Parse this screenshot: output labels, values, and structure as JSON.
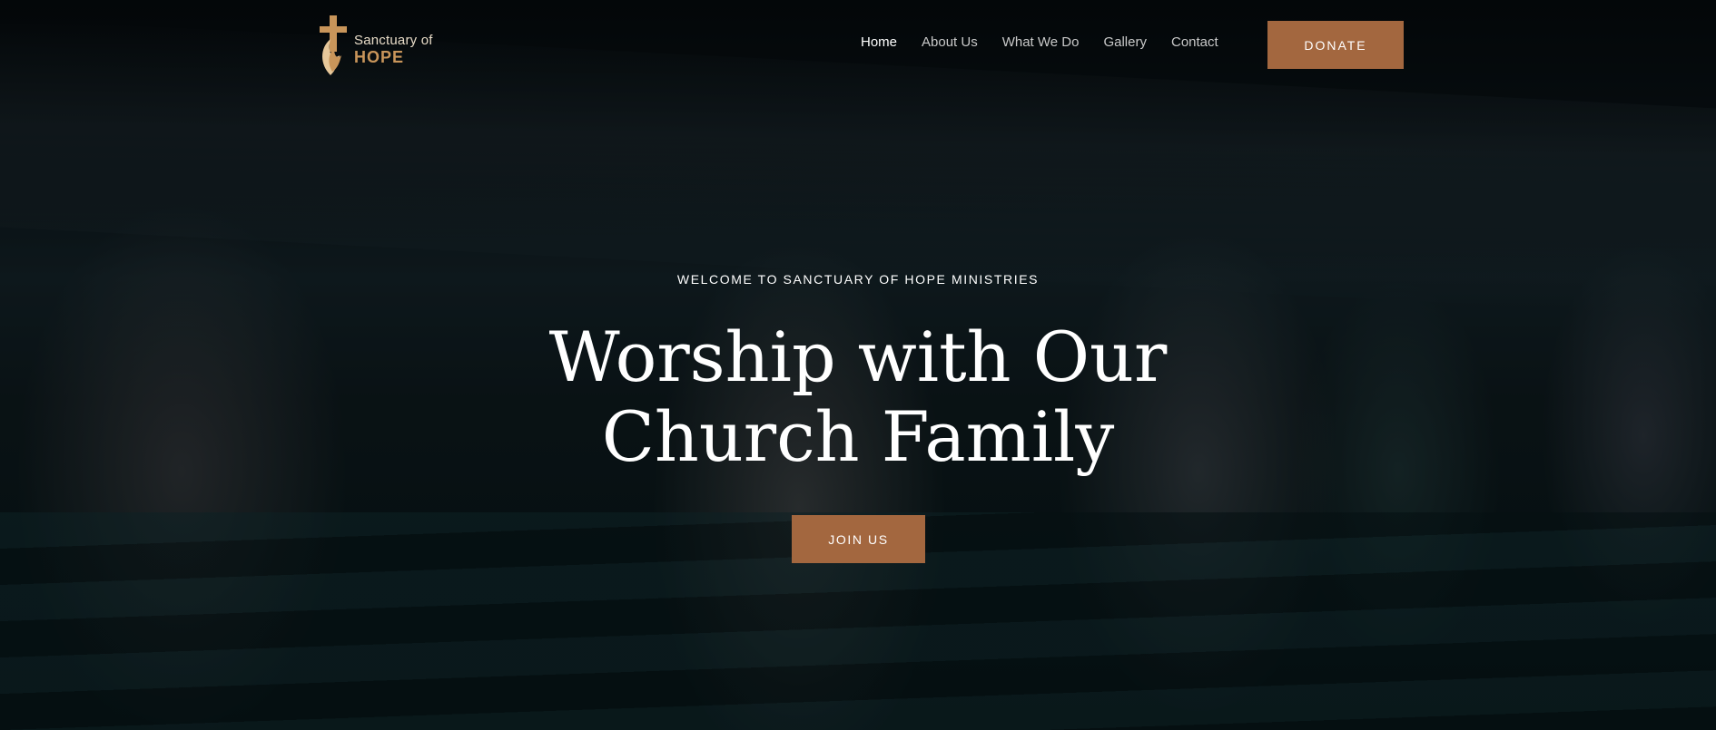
{
  "brand": {
    "name_line1": "Sanctuary of",
    "name_line2": "HOPE",
    "logo_icon": "cross-flame-icon",
    "colors": {
      "accent": "#a3673f",
      "gold": "#c8955a"
    }
  },
  "nav": {
    "items": [
      {
        "label": "Home",
        "active": true
      },
      {
        "label": "About Us",
        "active": false
      },
      {
        "label": "What We Do",
        "active": false
      },
      {
        "label": "Gallery",
        "active": false
      },
      {
        "label": "Contact",
        "active": false
      }
    ],
    "donate_label": "DONATE"
  },
  "hero": {
    "eyebrow": "WELCOME TO SANCTUARY OF HOPE MINISTRIES",
    "headline_line1": "Worship with Our",
    "headline_line2": "Church Family",
    "cta_label": "JOIN US"
  }
}
